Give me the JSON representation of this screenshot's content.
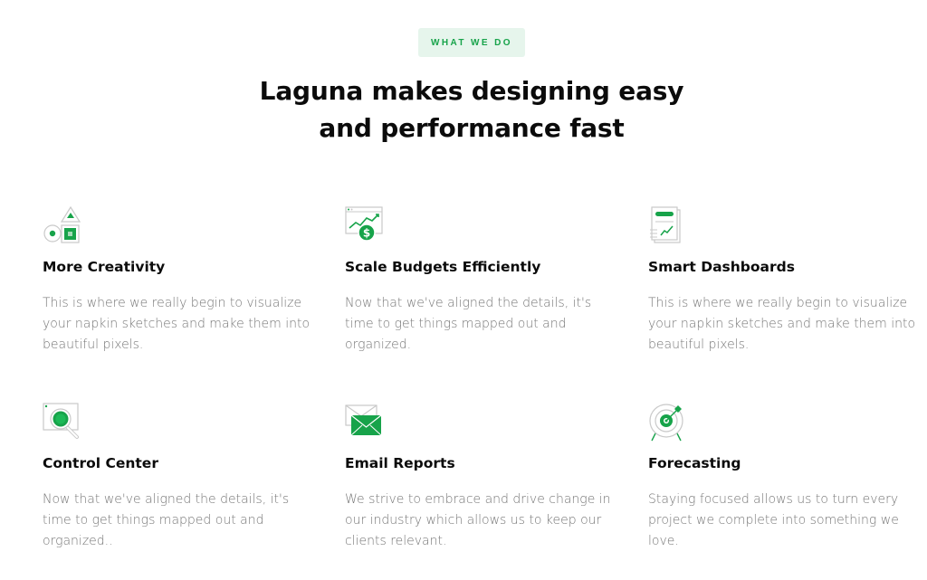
{
  "section": {
    "eyebrow": "WHAT WE DO",
    "headline_line1": "Laguna makes designing easy",
    "headline_line2": "and performance fast"
  },
  "colors": {
    "accent": "#17a34a",
    "eyebrow_bg": "#e6f5ec",
    "body_text": "#777777",
    "heading": "#0b0b0b"
  },
  "features": [
    {
      "icon": "shapes-icon",
      "title": "More Creativity",
      "description": "This is where we really begin to visualize your napkin sketches and make them into beautiful pixels."
    },
    {
      "icon": "budget-chart-icon",
      "title": "Scale Budgets Efficiently",
      "description": "Now that we've aligned the details, it's time to get things mapped out and organized."
    },
    {
      "icon": "dashboard-document-icon",
      "title": "Smart Dashboards",
      "description": "This is where we really begin to visualize your napkin sketches and make them into beautiful pixels."
    },
    {
      "icon": "magnifier-icon",
      "title": "Control Center",
      "description": "Now that we've aligned the details, it's time to get things mapped out and organized.."
    },
    {
      "icon": "envelope-icon",
      "title": "Email Reports",
      "description": "We strive to embrace and drive change in our industry which allows us to keep our clients relevant."
    },
    {
      "icon": "target-icon",
      "title": "Forecasting",
      "description": "Staying focused allows us to turn every project we complete into something we love."
    }
  ]
}
